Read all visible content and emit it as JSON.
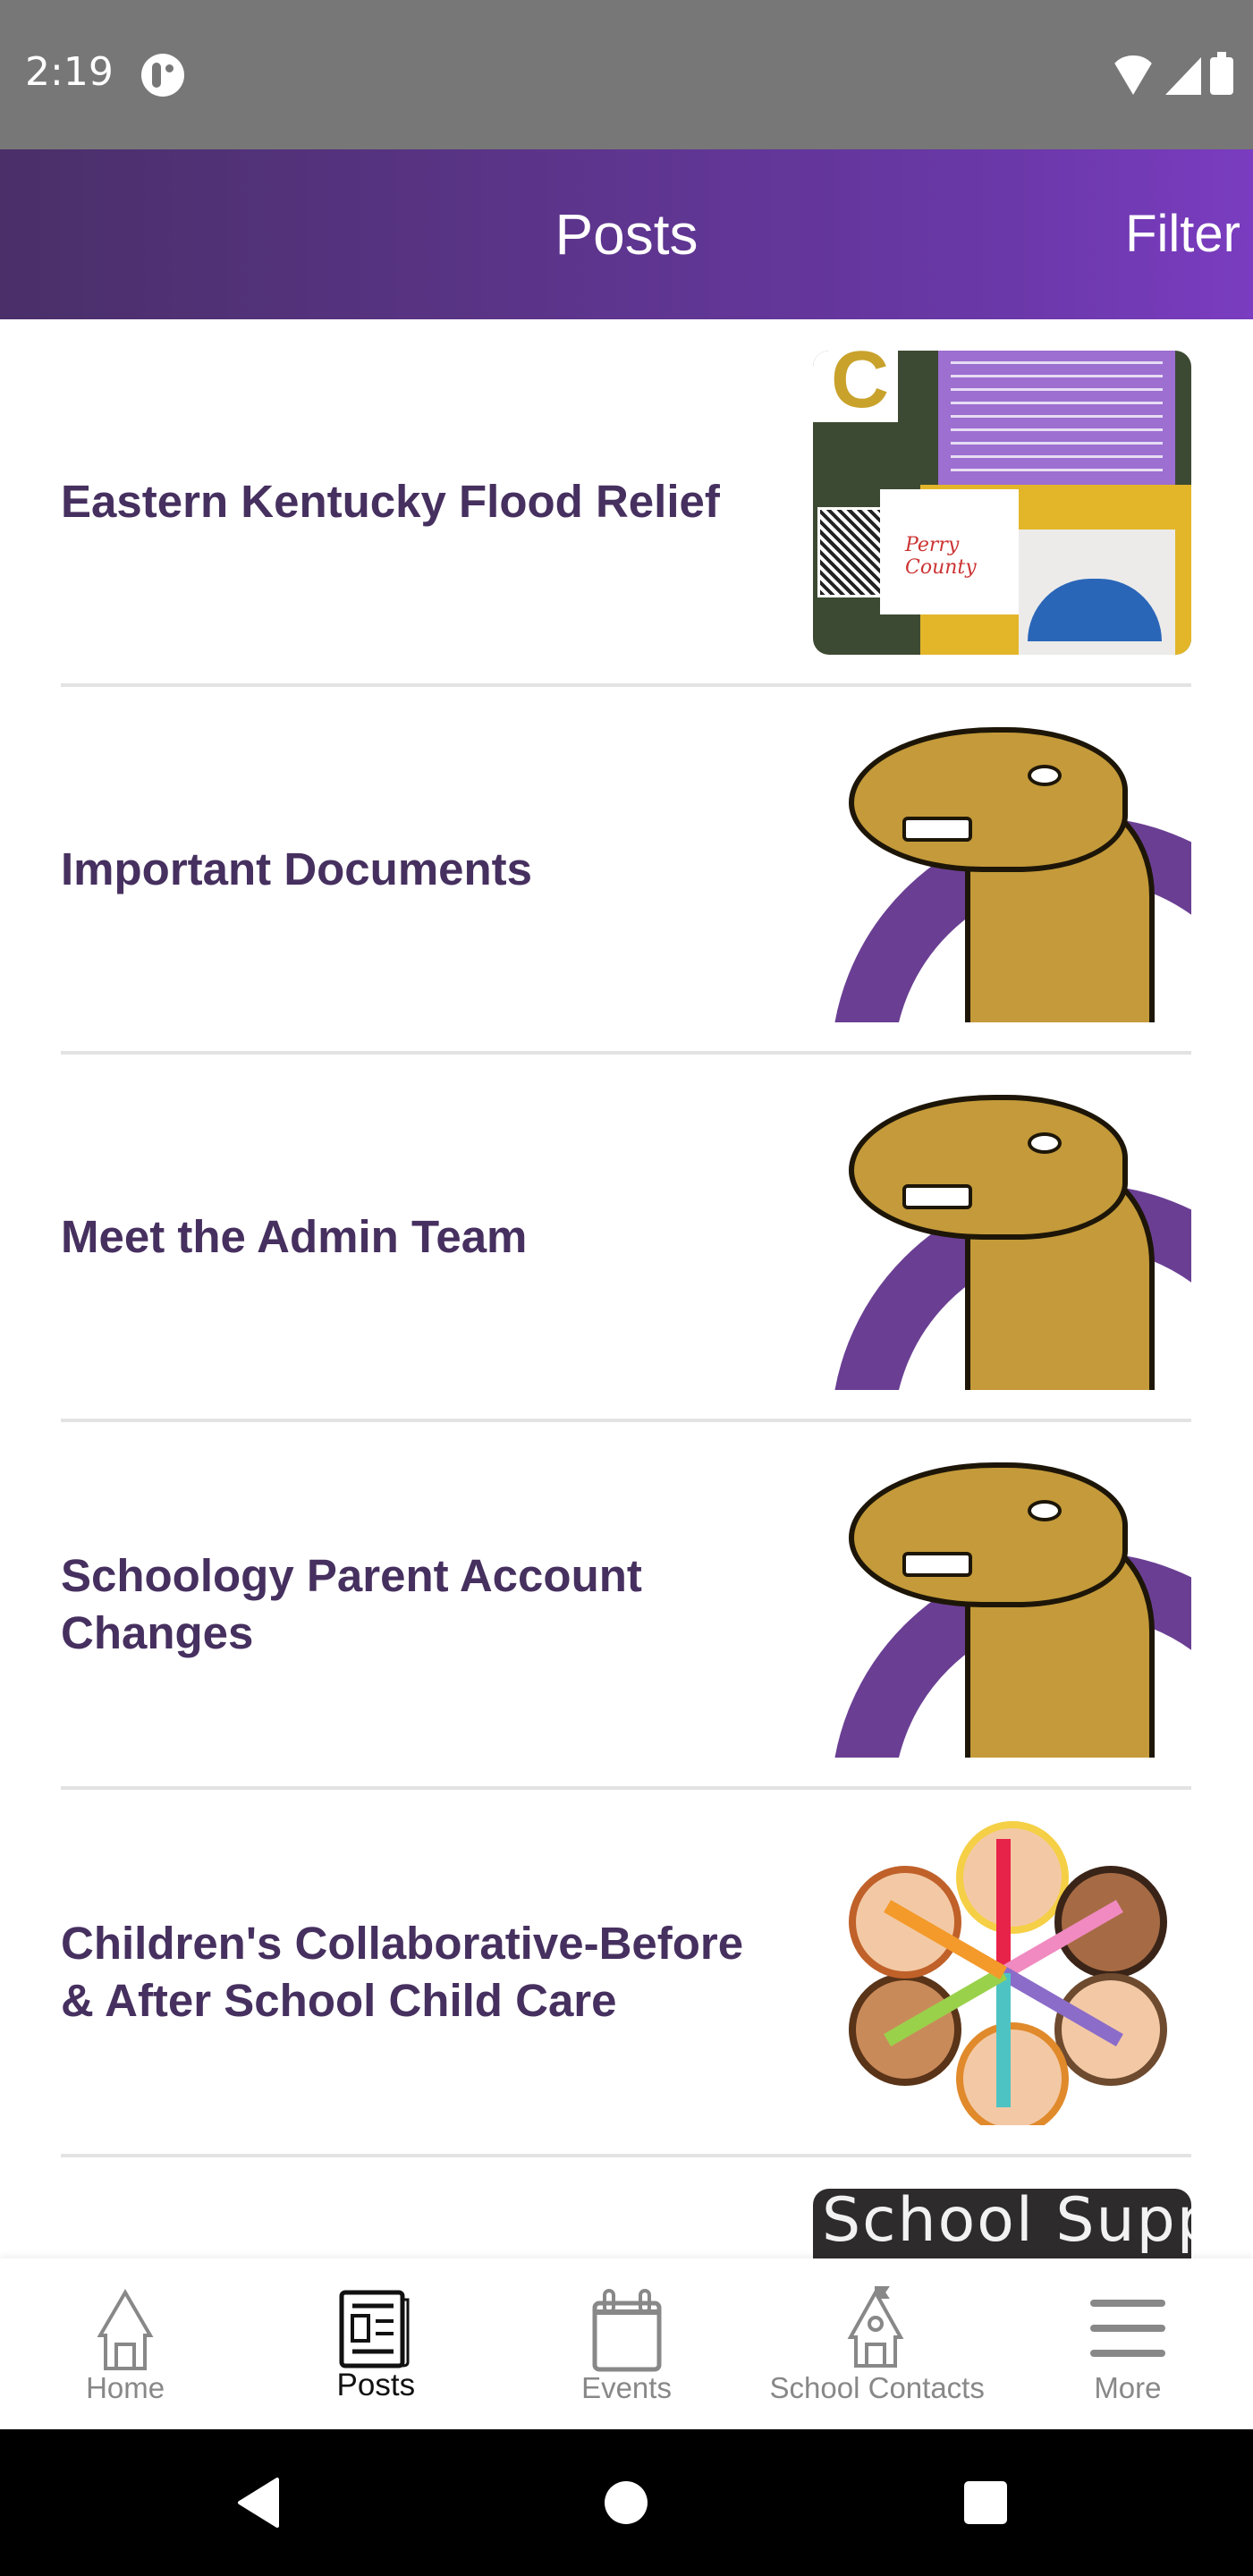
{
  "status_bar": {
    "time": "2:19",
    "icons": [
      "app-notification-icon",
      "wifi-icon",
      "cellular-signal-icon",
      "battery-icon"
    ]
  },
  "header": {
    "title": "Posts",
    "filter_label": "Filter",
    "gradient": [
      "#4a2f69",
      "#7a3cc0"
    ]
  },
  "posts": [
    {
      "title": "Eastern Kentucky Flood Relief",
      "thumbnail": "flood-relief-flyer"
    },
    {
      "title": "Important Documents",
      "thumbnail": "camel-mascot-logo"
    },
    {
      "title": "Meet the Admin Team",
      "thumbnail": "camel-mascot-logo"
    },
    {
      "title": "Schoology Parent Account Changes",
      "thumbnail": "camel-mascot-logo"
    },
    {
      "title": "Children's Collaborative-Before & After School Child Care",
      "thumbnail": "children-circle-illustration"
    },
    {
      "title": "",
      "thumbnail": "school-supplies-chalkboard",
      "thumbnail_text": "School Suppli"
    }
  ],
  "bottom_nav": {
    "items": [
      {
        "label": "Home",
        "icon": "home-icon",
        "active": false
      },
      {
        "label": "Posts",
        "icon": "newspaper-icon",
        "active": true
      },
      {
        "label": "Events",
        "icon": "calendar-icon",
        "active": false
      },
      {
        "label": "School Contacts",
        "icon": "school-icon",
        "active": false
      },
      {
        "label": "More",
        "icon": "menu-icon",
        "active": false
      }
    ]
  },
  "colors": {
    "title_text": "#46305f",
    "nav_inactive": "#888888",
    "nav_active": "#111111",
    "divider": "#e3e3e3"
  }
}
